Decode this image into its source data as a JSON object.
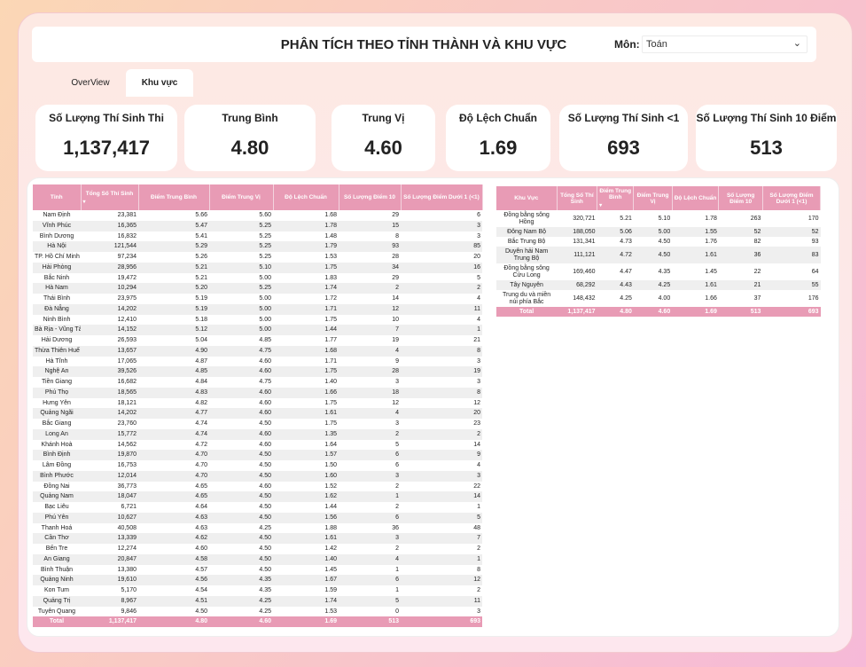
{
  "header": {
    "title": "PHÂN TÍCH THEO TỈNH THÀNH VÀ KHU VỰC",
    "subject_label": "Môn:",
    "subject_value": "Toán"
  },
  "tabs": [
    {
      "label": "OverView"
    },
    {
      "label": "Khu vực"
    }
  ],
  "kpis": [
    {
      "label": "Số Lượng Thí Sinh Thi",
      "value": "1,137,417"
    },
    {
      "label": "Trung Bình",
      "value": "4.80"
    },
    {
      "label": "Trung Vị",
      "value": "4.60"
    },
    {
      "label": "Độ Lệch Chuẩn",
      "value": "1.69"
    },
    {
      "label": "Số Lượng Thí Sinh <1",
      "value": "693"
    },
    {
      "label": "Số Lượng Thí Sinh 10 Điểm",
      "value": "513"
    }
  ],
  "province_table": {
    "headers": [
      "Tỉnh",
      "Tổng Số Thí Sinh",
      "Điểm Trung Bình",
      "Điểm Trung Vị",
      "Độ Lệch Chuẩn",
      "Số Lượng Điểm 10",
      "Số Lượng Điểm Dưới 1 (<1)"
    ],
    "rows": [
      [
        "Nam Định",
        "23,381",
        "5.66",
        "5.60",
        "1.68",
        "29",
        "6"
      ],
      [
        "Vĩnh Phúc",
        "16,365",
        "5.47",
        "5.25",
        "1.78",
        "15",
        "3"
      ],
      [
        "Bình Dương",
        "16,832",
        "5.41",
        "5.25",
        "1.48",
        "8",
        "3"
      ],
      [
        "Hà Nội",
        "121,544",
        "5.29",
        "5.25",
        "1.79",
        "93",
        "85"
      ],
      [
        "TP. Hồ Chí Minh",
        "97,234",
        "5.26",
        "5.25",
        "1.53",
        "28",
        "20"
      ],
      [
        "Hải Phòng",
        "28,956",
        "5.21",
        "5.10",
        "1.75",
        "34",
        "16"
      ],
      [
        "Bắc Ninh",
        "19,472",
        "5.21",
        "5.00",
        "1.83",
        "29",
        "5"
      ],
      [
        "Hà Nam",
        "10,294",
        "5.20",
        "5.25",
        "1.74",
        "2",
        "2"
      ],
      [
        "Thái Bình",
        "23,975",
        "5.19",
        "5.00",
        "1.72",
        "14",
        "4"
      ],
      [
        "Đà Nẵng",
        "14,202",
        "5.19",
        "5.00",
        "1.71",
        "12",
        "11"
      ],
      [
        "Ninh Bình",
        "12,410",
        "5.18",
        "5.00",
        "1.75",
        "10",
        "4"
      ],
      [
        "Bà Rịa - Vũng Tàu",
        "14,152",
        "5.12",
        "5.00",
        "1.44",
        "7",
        "1"
      ],
      [
        "Hải Dương",
        "26,593",
        "5.04",
        "4.85",
        "1.77",
        "19",
        "21"
      ],
      [
        "Thừa Thiên Huế",
        "13,657",
        "4.90",
        "4.75",
        "1.68",
        "4",
        "8"
      ],
      [
        "Hà Tĩnh",
        "17,065",
        "4.87",
        "4.60",
        "1.71",
        "9",
        "3"
      ],
      [
        "Nghệ An",
        "39,526",
        "4.85",
        "4.60",
        "1.75",
        "28",
        "19"
      ],
      [
        "Tiền Giang",
        "16,682",
        "4.84",
        "4.75",
        "1.40",
        "3",
        "3"
      ],
      [
        "Phú Thọ",
        "18,565",
        "4.83",
        "4.60",
        "1.66",
        "18",
        "8"
      ],
      [
        "Hưng Yên",
        "18,121",
        "4.82",
        "4.60",
        "1.75",
        "12",
        "12"
      ],
      [
        "Quảng Ngãi",
        "14,202",
        "4.77",
        "4.60",
        "1.61",
        "4",
        "20"
      ],
      [
        "Bắc Giang",
        "23,760",
        "4.74",
        "4.50",
        "1.75",
        "3",
        "23"
      ],
      [
        "Long An",
        "15,772",
        "4.74",
        "4.60",
        "1.35",
        "2",
        "2"
      ],
      [
        "Khánh Hoà",
        "14,562",
        "4.72",
        "4.60",
        "1.64",
        "5",
        "14"
      ],
      [
        "Bình Định",
        "19,870",
        "4.70",
        "4.50",
        "1.57",
        "6",
        "9"
      ],
      [
        "Lâm Đồng",
        "16,753",
        "4.70",
        "4.50",
        "1.50",
        "6",
        "4"
      ],
      [
        "Bình Phước",
        "12,014",
        "4.70",
        "4.50",
        "1.60",
        "3",
        "3"
      ],
      [
        "Đồng Nai",
        "36,773",
        "4.65",
        "4.60",
        "1.52",
        "2",
        "22"
      ],
      [
        "Quảng Nam",
        "18,047",
        "4.65",
        "4.50",
        "1.62",
        "1",
        "14"
      ],
      [
        "Bạc Liêu",
        "6,721",
        "4.64",
        "4.50",
        "1.44",
        "2",
        "1"
      ],
      [
        "Phú Yên",
        "10,627",
        "4.63",
        "4.50",
        "1.56",
        "6",
        "5"
      ],
      [
        "Thanh Hoá",
        "40,508",
        "4.63",
        "4.25",
        "1.88",
        "36",
        "48"
      ],
      [
        "Cần Thơ",
        "13,339",
        "4.62",
        "4.50",
        "1.61",
        "3",
        "7"
      ],
      [
        "Bến Tre",
        "12,274",
        "4.60",
        "4.50",
        "1.42",
        "2",
        "2"
      ],
      [
        "An Giang",
        "20,847",
        "4.58",
        "4.50",
        "1.40",
        "4",
        "1"
      ],
      [
        "Bình Thuận",
        "13,380",
        "4.57",
        "4.50",
        "1.45",
        "1",
        "8"
      ],
      [
        "Quảng Ninh",
        "19,610",
        "4.56",
        "4.35",
        "1.67",
        "6",
        "12"
      ],
      [
        "Kon Tum",
        "5,170",
        "4.54",
        "4.35",
        "1.59",
        "1",
        "2"
      ],
      [
        "Quảng Trị",
        "8,967",
        "4.51",
        "4.25",
        "1.74",
        "5",
        "11"
      ],
      [
        "Tuyên Quang",
        "9,846",
        "4.50",
        "4.25",
        "1.53",
        "0",
        "3"
      ]
    ],
    "total": [
      "Total",
      "1,137,417",
      "4.80",
      "4.60",
      "1.69",
      "513",
      "693"
    ]
  },
  "region_table": {
    "headers": [
      "Khu Vực",
      "Tổng Số Thí Sinh",
      "Điểm Trung Bình",
      "Điểm Trung Vị",
      "Độ Lệch Chuẩn",
      "Số Lượng Điểm 10",
      "Số Lượng Điểm Dưới 1 (<1)"
    ],
    "rows": [
      [
        "Đồng bằng sông Hồng",
        "320,721",
        "5.21",
        "5.10",
        "1.78",
        "263",
        "170"
      ],
      [
        "Đông Nam Bộ",
        "188,050",
        "5.06",
        "5.00",
        "1.55",
        "52",
        "52"
      ],
      [
        "Bắc Trung Bộ",
        "131,341",
        "4.73",
        "4.50",
        "1.76",
        "82",
        "93"
      ],
      [
        "Duyên hải Nam Trung Bộ",
        "111,121",
        "4.72",
        "4.50",
        "1.61",
        "36",
        "83"
      ],
      [
        "Đồng bằng sông Cửu Long",
        "169,460",
        "4.47",
        "4.35",
        "1.45",
        "22",
        "64"
      ],
      [
        "Tây Nguyên",
        "68,292",
        "4.43",
        "4.25",
        "1.61",
        "21",
        "55"
      ],
      [
        "Trung du và miền núi phía Bắc",
        "148,432",
        "4.25",
        "4.00",
        "1.66",
        "37",
        "176"
      ]
    ],
    "total": [
      "Total",
      "1,137,417",
      "4.80",
      "4.60",
      "1.69",
      "513",
      "693"
    ]
  },
  "colors": {
    "accent": "#e89bb5",
    "row_alt": "#efefef"
  }
}
